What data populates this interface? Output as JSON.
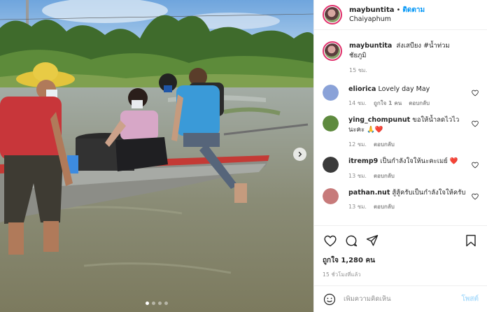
{
  "post": {
    "username": "maybuntita",
    "separator": "•",
    "follow_label": "ติดตาม",
    "location": "Chaiyaphum",
    "caption": {
      "username": "maybuntita",
      "text": "ส่งเสบียง #น้ำท่วมชัยภูมิ",
      "time": "15 ชม."
    },
    "comments": [
      {
        "username": "eliorica",
        "text": "Lovely day May",
        "time": "14 ชม.",
        "likes": "ถูกใจ 1 คน",
        "reply": "ตอบกลับ",
        "avatar_color": "#8aa2d8"
      },
      {
        "username": "ying_chompunut",
        "text": "ขอให้น้ำลดไวไวนะคะ 🙏❤️",
        "time": "12 ชม.",
        "likes": "",
        "reply": "ตอบกลับ",
        "avatar_color": "#5e8a3e"
      },
      {
        "username": "itremp9",
        "text": "เป็นกำลังใจให้นะคะเมย์ ❤️",
        "time": "13 ชม.",
        "likes": "",
        "reply": "ตอบกลับ",
        "avatar_color": "#3a3a3a"
      },
      {
        "username": "pathan.nut",
        "text": "สู้สู้ครับเป็นกำลังใจให้ครับ",
        "time": "13 ชม.",
        "likes": "",
        "reply": "ตอบกลับ",
        "avatar_color": "#c77a7a"
      }
    ],
    "likes_text": "ถูกใจ 1,280 คน",
    "time_ago": "15 ชั่วโมงที่แล้ว",
    "add_comment_placeholder": "เพิ่มความคิดเห็น",
    "post_label": "โพสต์"
  },
  "carousel": {
    "total": 4,
    "active": 0
  },
  "icons": {
    "like": "heart-icon",
    "comment": "comment-icon",
    "share": "share-icon",
    "save": "bookmark-icon",
    "emoji": "emoji-icon",
    "next": "chevron-right-icon"
  },
  "colors": {
    "follow": "#0095f6",
    "post_button": "#b2dffc",
    "text": "#262626",
    "muted": "#8e8e8e",
    "story_ring": "#e1306c"
  }
}
